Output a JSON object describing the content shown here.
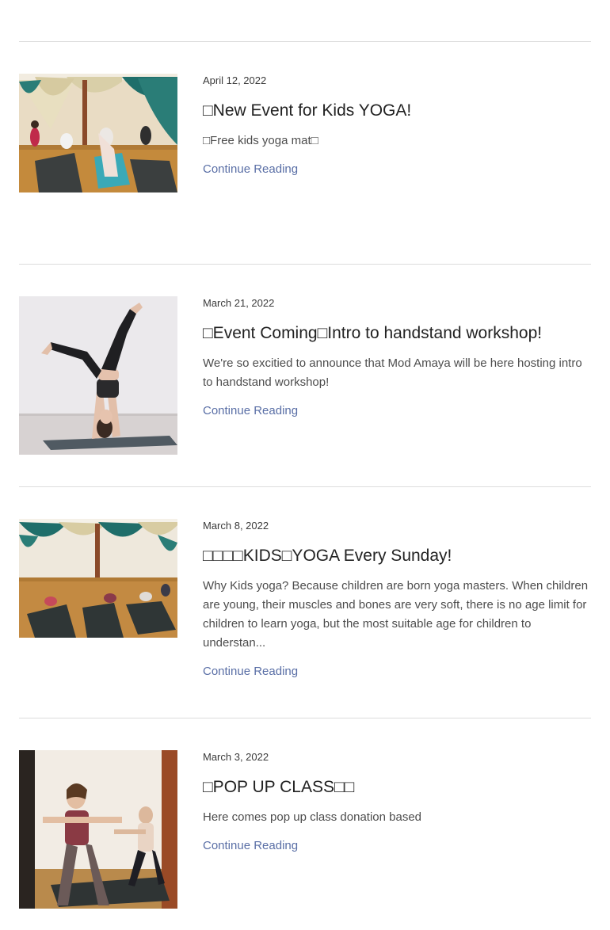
{
  "posts": [
    {
      "date": "April 12, 2022",
      "title": "□New Event for Kids YOGA!",
      "excerpt": "□Free kids yoga mat□",
      "link_label": "Continue Reading",
      "image_label": "Kids aerial yoga studio class"
    },
    {
      "date": "March 21, 2022",
      "title": "□Event Coming□Intro to handstand workshop!",
      "excerpt": "We're so excitied to announce that Mod Amaya will be here hosting intro to handstand workshop!",
      "link_label": "Continue Reading",
      "image_label": "Woman doing a handstand on a yoga mat"
    },
    {
      "date": "March 8, 2022",
      "title": "□□□□KIDS□YOGA Every Sunday!",
      "excerpt": "Why Kids yoga? Because children are born yoga masters. When children are young, their muscles and bones are very soft, there is no age limit for children to learn yoga, but the most suitable age for children to understan...",
      "link_label": "Continue Reading",
      "image_label": "Kids yoga class in studio"
    },
    {
      "date": "March 3, 2022",
      "title": "□POP UP CLASS□□",
      "excerpt": "Here comes pop up class donation based",
      "link_label": "Continue Reading",
      "image_label": "Two women in warrior pose"
    }
  ],
  "colors": {
    "link": "#5a6fa6",
    "divider": "#dcdcdc",
    "title": "#222222",
    "text": "#4d4d4d"
  }
}
